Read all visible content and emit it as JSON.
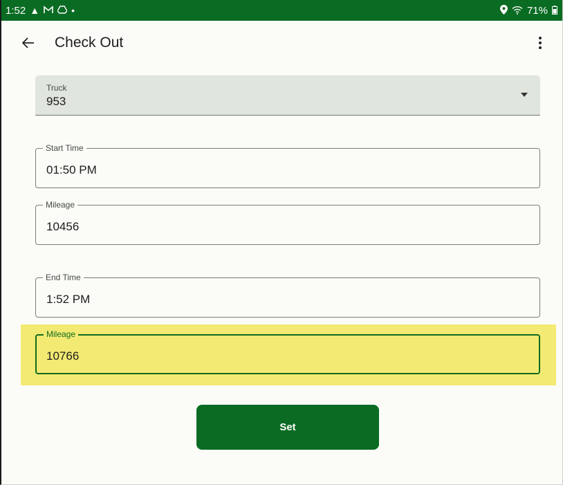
{
  "status_bar": {
    "time": "1:52",
    "left_icons": [
      "navigation-icon",
      "gmail-icon",
      "drive-icon",
      "dot-icon"
    ],
    "battery": "71%",
    "right_icons": [
      "location-icon",
      "wifi-icon",
      "battery-icon"
    ]
  },
  "app_bar": {
    "back_icon": "back-arrow-icon",
    "title": "Check Out",
    "more_icon": "more-vert-icon"
  },
  "truck_dropdown": {
    "label": "Truck",
    "value": "953"
  },
  "start_time_field": {
    "label": "Start Time",
    "value": "01:50 PM"
  },
  "start_mileage_field": {
    "label": "Mileage",
    "value": "10456"
  },
  "end_time_field": {
    "label": "End Time",
    "value": "1:52 PM"
  },
  "end_mileage_field": {
    "label": "Mileage",
    "value": "10766"
  },
  "set_button": {
    "label": "Set"
  },
  "colors": {
    "primary": "#0a6b23",
    "highlight": "#f2ea72",
    "background": "#fbfcf7",
    "dropdown_fill": "#e0e5dd"
  }
}
